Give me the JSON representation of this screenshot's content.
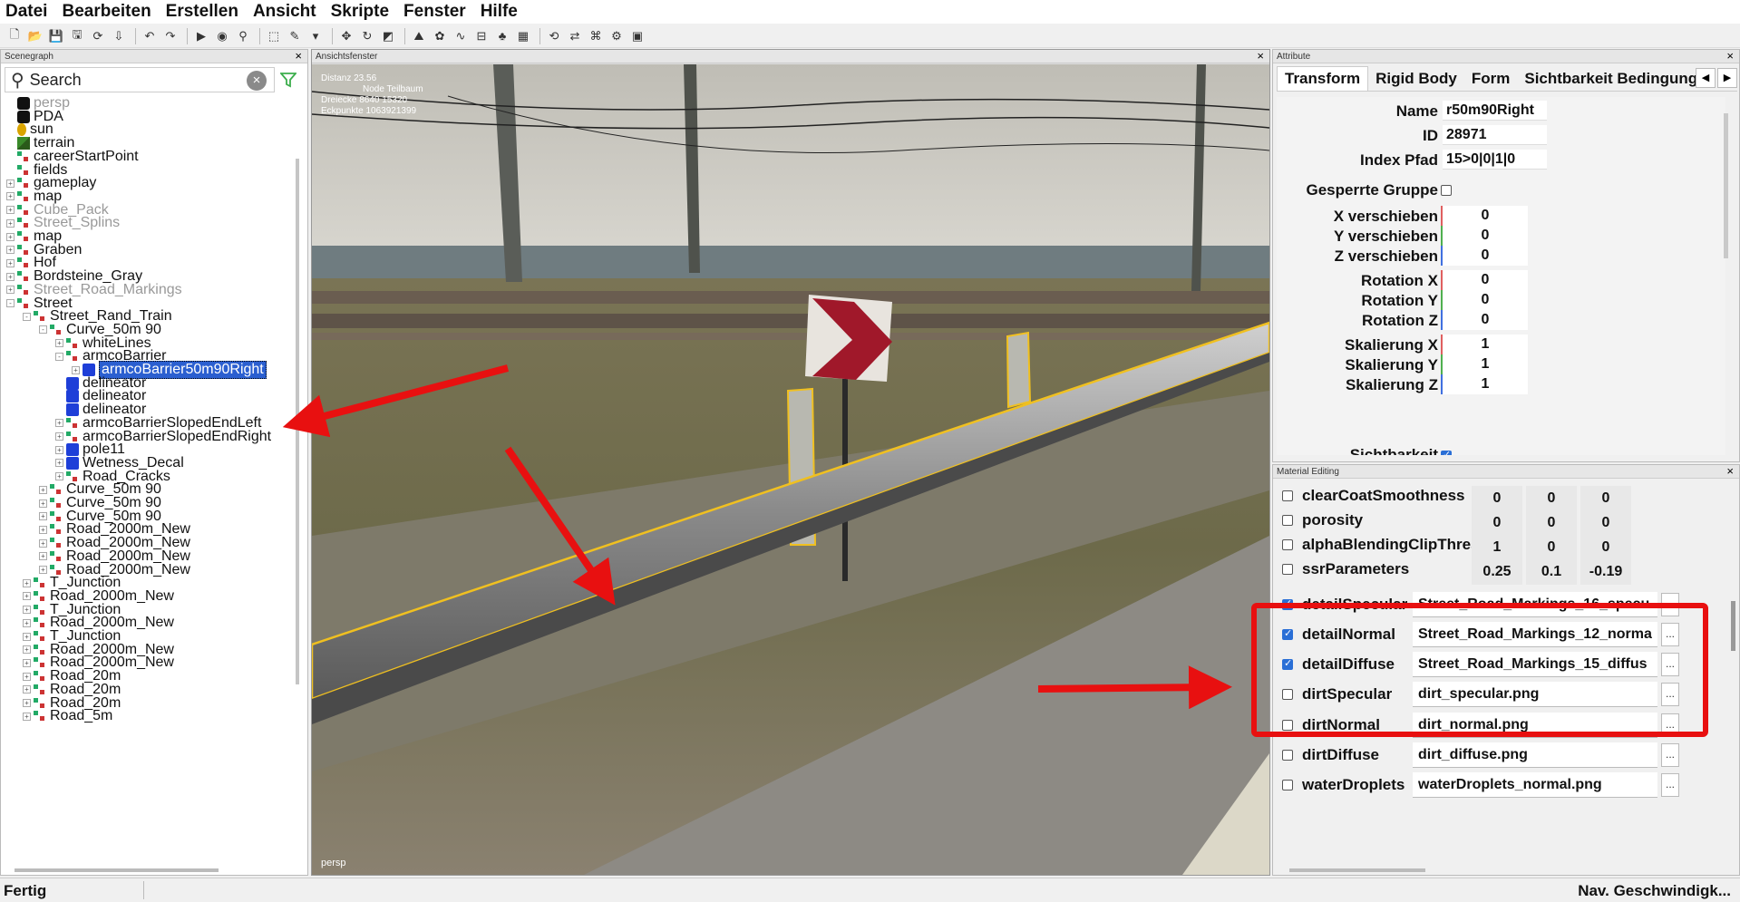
{
  "menu": [
    "Datei",
    "Bearbeiten",
    "Erstellen",
    "Ansicht",
    "Skripte",
    "Fenster",
    "Hilfe"
  ],
  "toolbar_icons": [
    "new-icon",
    "open-icon",
    "save-icon",
    "save-as-icon",
    "refresh-icon",
    "import-icon",
    "undo-icon",
    "redo-icon",
    "play-icon",
    "eye-icon",
    "zoom-icon",
    "select-icon",
    "paint-icon",
    "dropdown-icon",
    "move-icon",
    "rotate-icon",
    "scale-icon",
    "terrain-tool-icon",
    "foliage-tool-icon",
    "spline-tool-icon",
    "road-tool-icon",
    "tree-tool-icon",
    "field-tool-icon",
    "reload-icon",
    "sync-icon",
    "network-icon",
    "settings-icon",
    "capture-icon"
  ],
  "scenegraph": {
    "title": "Scenegraph",
    "close": "×",
    "search_placeholder": "Search",
    "clear": "×",
    "items": [
      {
        "label": "persp",
        "depth": 1,
        "icon": "camera",
        "dim": true,
        "exp": ""
      },
      {
        "label": "PDA",
        "depth": 1,
        "icon": "camera",
        "dim": false,
        "exp": ""
      },
      {
        "label": "sun",
        "depth": 1,
        "icon": "sun",
        "dim": false,
        "exp": ""
      },
      {
        "label": "terrain",
        "depth": 1,
        "icon": "terrain",
        "dim": false,
        "exp": ""
      },
      {
        "label": "careerStartPoint",
        "depth": 1,
        "icon": "node",
        "dim": false,
        "exp": ""
      },
      {
        "label": "fields",
        "depth": 1,
        "icon": "node",
        "dim": false,
        "exp": ""
      },
      {
        "label": "gameplay",
        "depth": 1,
        "icon": "node",
        "dim": false,
        "exp": "+"
      },
      {
        "label": "map",
        "depth": 1,
        "icon": "node",
        "dim": false,
        "exp": "+"
      },
      {
        "label": "Cube_Pack",
        "depth": 1,
        "icon": "node",
        "dim": true,
        "exp": "+"
      },
      {
        "label": "Street_Splins",
        "depth": 1,
        "icon": "node",
        "dim": true,
        "exp": "+"
      },
      {
        "label": "map",
        "depth": 1,
        "icon": "node",
        "dim": false,
        "exp": "+"
      },
      {
        "label": "Graben",
        "depth": 1,
        "icon": "node",
        "dim": false,
        "exp": "+"
      },
      {
        "label": "Hof",
        "depth": 1,
        "icon": "node",
        "dim": false,
        "exp": "+"
      },
      {
        "label": "Bordsteine_Gray",
        "depth": 1,
        "icon": "node",
        "dim": false,
        "exp": "+"
      },
      {
        "label": "Street_Road_Markings",
        "depth": 1,
        "icon": "node",
        "dim": true,
        "exp": "+"
      },
      {
        "label": "Street",
        "depth": 1,
        "icon": "node",
        "dim": false,
        "exp": "-"
      },
      {
        "label": "Street_Rand_Train",
        "depth": 2,
        "icon": "node",
        "dim": false,
        "exp": "-"
      },
      {
        "label": "Curve_50m 90",
        "depth": 3,
        "icon": "node",
        "dim": false,
        "exp": "-"
      },
      {
        "label": "whiteLines",
        "depth": 4,
        "icon": "node",
        "dim": false,
        "exp": "+"
      },
      {
        "label": "armcoBarrier",
        "depth": 4,
        "icon": "node",
        "dim": false,
        "exp": "-"
      },
      {
        "label": "armcoBarrier50m90Right",
        "depth": 5,
        "icon": "cube",
        "dim": false,
        "exp": "+",
        "selected": true
      },
      {
        "label": "delineator",
        "depth": 4,
        "icon": "cube",
        "dim": false,
        "exp": ""
      },
      {
        "label": "delineator",
        "depth": 4,
        "icon": "cube",
        "dim": false,
        "exp": ""
      },
      {
        "label": "delineator",
        "depth": 4,
        "icon": "cube",
        "dim": false,
        "exp": ""
      },
      {
        "label": "armcoBarrierSlopedEndLeft",
        "depth": 4,
        "icon": "node",
        "dim": false,
        "exp": "+"
      },
      {
        "label": "armcoBarrierSlopedEndRight",
        "depth": 4,
        "icon": "node",
        "dim": false,
        "exp": "+"
      },
      {
        "label": "pole11",
        "depth": 4,
        "icon": "cube",
        "dim": false,
        "exp": "+"
      },
      {
        "label": "Wetness_Decal",
        "depth": 4,
        "icon": "cube",
        "dim": false,
        "exp": "+"
      },
      {
        "label": "Road_Cracks",
        "depth": 4,
        "icon": "node",
        "dim": false,
        "exp": "+"
      },
      {
        "label": "Curve_50m 90",
        "depth": 3,
        "icon": "node",
        "dim": false,
        "exp": "+"
      },
      {
        "label": "Curve_50m 90",
        "depth": 3,
        "icon": "node",
        "dim": false,
        "exp": "+"
      },
      {
        "label": "Curve_50m 90",
        "depth": 3,
        "icon": "node",
        "dim": false,
        "exp": "+"
      },
      {
        "label": "Road_2000m_New",
        "depth": 3,
        "icon": "node",
        "dim": false,
        "exp": "+"
      },
      {
        "label": "Road_2000m_New",
        "depth": 3,
        "icon": "node",
        "dim": false,
        "exp": "+"
      },
      {
        "label": "Road_2000m_New",
        "depth": 3,
        "icon": "node",
        "dim": false,
        "exp": "+"
      },
      {
        "label": "Road_2000m_New",
        "depth": 3,
        "icon": "node",
        "dim": false,
        "exp": "+"
      },
      {
        "label": "T_Junction",
        "depth": 2,
        "icon": "node",
        "dim": false,
        "exp": "+"
      },
      {
        "label": "Road_2000m_New",
        "depth": 2,
        "icon": "node",
        "dim": false,
        "exp": "+"
      },
      {
        "label": "T_Junction",
        "depth": 2,
        "icon": "node",
        "dim": false,
        "exp": "+"
      },
      {
        "label": "Road_2000m_New",
        "depth": 2,
        "icon": "node",
        "dim": false,
        "exp": "+"
      },
      {
        "label": "T_Junction",
        "depth": 2,
        "icon": "node",
        "dim": false,
        "exp": "+"
      },
      {
        "label": "Road_2000m_New",
        "depth": 2,
        "icon": "node",
        "dim": false,
        "exp": "+"
      },
      {
        "label": "Road_2000m_New",
        "depth": 2,
        "icon": "node",
        "dim": false,
        "exp": "+"
      },
      {
        "label": "Road_20m",
        "depth": 2,
        "icon": "node",
        "dim": false,
        "exp": "+"
      },
      {
        "label": "Road_20m",
        "depth": 2,
        "icon": "node",
        "dim": false,
        "exp": "+"
      },
      {
        "label": "Road_20m",
        "depth": 2,
        "icon": "node",
        "dim": false,
        "exp": "+"
      },
      {
        "label": "Road_5m",
        "depth": 2,
        "icon": "node",
        "dim": false,
        "exp": "+"
      }
    ]
  },
  "viewport": {
    "title": "Ansichtsfenster",
    "close": "×",
    "info": [
      "Distanz 23.56",
      "Node Teilbaum",
      "Dreiecke 8640 15320",
      "Eckpunkte 1063921399"
    ],
    "camera": "persp"
  },
  "attributes": {
    "title": "Attribute",
    "close": "×",
    "tabs": [
      "Transform",
      "Rigid Body",
      "Form",
      "Sichtbarkeit Bedingung"
    ],
    "tab_prev": "◀",
    "tab_next": "▶",
    "name_label": "Name",
    "name_value": "r50m90Right",
    "id_label": "ID",
    "id_value": "28971",
    "index_label": "Index Pfad",
    "index_value": "15>0|0|1|0",
    "locked_label": "Gesperrte Gruppe",
    "transforms": [
      {
        "label": "X verschieben",
        "value": "0",
        "axis": "x"
      },
      {
        "label": "Y verschieben",
        "value": "0",
        "axis": "y"
      },
      {
        "label": "Z verschieben",
        "value": "0",
        "axis": "z"
      },
      {
        "label": "Rotation X",
        "value": "0",
        "axis": "x"
      },
      {
        "label": "Rotation Y",
        "value": "0",
        "axis": "y"
      },
      {
        "label": "Rotation Z",
        "value": "0",
        "axis": "z"
      },
      {
        "label": "Skalierung X",
        "value": "1",
        "axis": "x"
      },
      {
        "label": "Skalierung Y",
        "value": "1",
        "axis": "y"
      },
      {
        "label": "Skalierung Z",
        "value": "1",
        "axis": "z"
      }
    ],
    "visibility_label": "Sichtbarkeit"
  },
  "material": {
    "title": "Material Editing",
    "close": "×",
    "rows": [
      {
        "name": "clearCoatSmoothness",
        "checked": false,
        "values": [
          "0",
          "0",
          "0"
        ]
      },
      {
        "name": "porosity",
        "checked": false,
        "values": [
          "0",
          "0",
          "0"
        ]
      },
      {
        "name": "alphaBlendingClipThreshold",
        "checked": false,
        "values": [
          "1",
          "0",
          "0"
        ]
      },
      {
        "name": "ssrParameters",
        "checked": false,
        "values": [
          "0.25",
          "0.1",
          "-0.19"
        ]
      }
    ],
    "files": [
      {
        "name": "detailSpecular",
        "checked": true,
        "file": "Street_Road_Markings_16_specu",
        "btn": "..."
      },
      {
        "name": "detailNormal",
        "checked": true,
        "file": "Street_Road_Markings_12_norma",
        "btn": "..."
      },
      {
        "name": "detailDiffuse",
        "checked": true,
        "file": "Street_Road_Markings_15_diffus",
        "btn": "..."
      },
      {
        "name": "dirtSpecular",
        "checked": false,
        "file": "dirt_specular.png",
        "btn": "..."
      },
      {
        "name": "dirtNormal",
        "checked": false,
        "file": "dirt_normal.png",
        "btn": "..."
      },
      {
        "name": "dirtDiffuse",
        "checked": false,
        "file": "dirt_diffuse.png",
        "btn": "..."
      },
      {
        "name": "waterDroplets",
        "checked": false,
        "file": "waterDroplets_normal.png",
        "btn": "..."
      }
    ]
  },
  "status": {
    "left": "Fertig",
    "right": "Nav. Geschwindigk..."
  },
  "colors": {
    "highlight_red": "#e81010",
    "selection_blue": "#2b5fd0",
    "object_outline": "#f0c020"
  }
}
